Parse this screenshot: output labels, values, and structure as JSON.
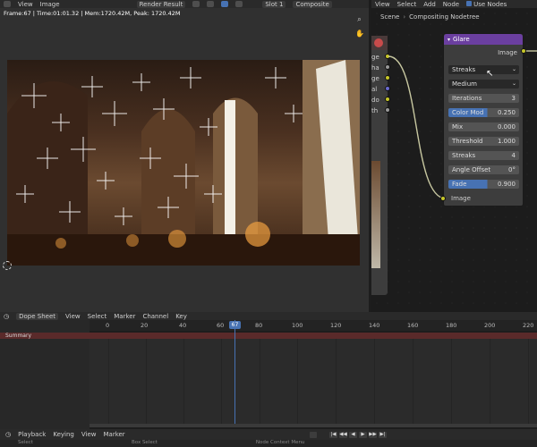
{
  "image_editor": {
    "menu": [
      "View",
      "Image"
    ],
    "image_name": "Render Result",
    "slot": "Slot 1",
    "layer": "Composite",
    "frame_info": "Frame:67 | Time:01:01.32 | Mem:1720.42M, Peak: 1720.42M"
  },
  "node_editor": {
    "menu": [
      "View",
      "Select",
      "Add",
      "Node"
    ],
    "use_nodes_label": "Use Nodes",
    "breadcrumb": [
      "Scene",
      "Compositing Nodetree"
    ]
  },
  "render_layers_node": {
    "sockets": [
      "Image",
      "Alpha",
      "Noise Image",
      "Normal",
      "Albedo",
      "Depth"
    ]
  },
  "glare_node": {
    "title": "Glare",
    "output_label": "Image",
    "glare_type": "Streaks",
    "quality": "Medium",
    "fields": [
      {
        "label": "Iterations",
        "value": "3"
      },
      {
        "label": "Color Mod",
        "value": "0.250"
      },
      {
        "label": "Mix",
        "value": "0.000"
      },
      {
        "label": "Threshold",
        "value": "1.000"
      },
      {
        "label": "Streaks",
        "value": "4"
      },
      {
        "label": "Angle Offset",
        "value": "0°"
      },
      {
        "label": "Fade",
        "value": "0.900"
      }
    ],
    "input_label": "Image",
    "colors": {
      "header": "#6b3fa0",
      "socket": "#c7c729",
      "accent": "#4772b3"
    }
  },
  "dope_sheet": {
    "mode": "Dope Sheet",
    "menu": [
      "View",
      "Select",
      "Marker",
      "Channel",
      "Key"
    ],
    "summary_label": "Summary",
    "current_frame": "67",
    "ticks": [
      "0",
      "20",
      "40",
      "60",
      "80",
      "100",
      "120",
      "140",
      "160",
      "180",
      "200",
      "220"
    ]
  },
  "playback": {
    "menu": [
      "Playback",
      "Keying",
      "View",
      "Marker"
    ],
    "controls": [
      "|◀",
      "◀◀",
      "◀",
      "▶",
      "▶▶",
      "▶|"
    ]
  },
  "status_bar": [
    "Select",
    "Box Select",
    "Node Context Menu"
  ]
}
